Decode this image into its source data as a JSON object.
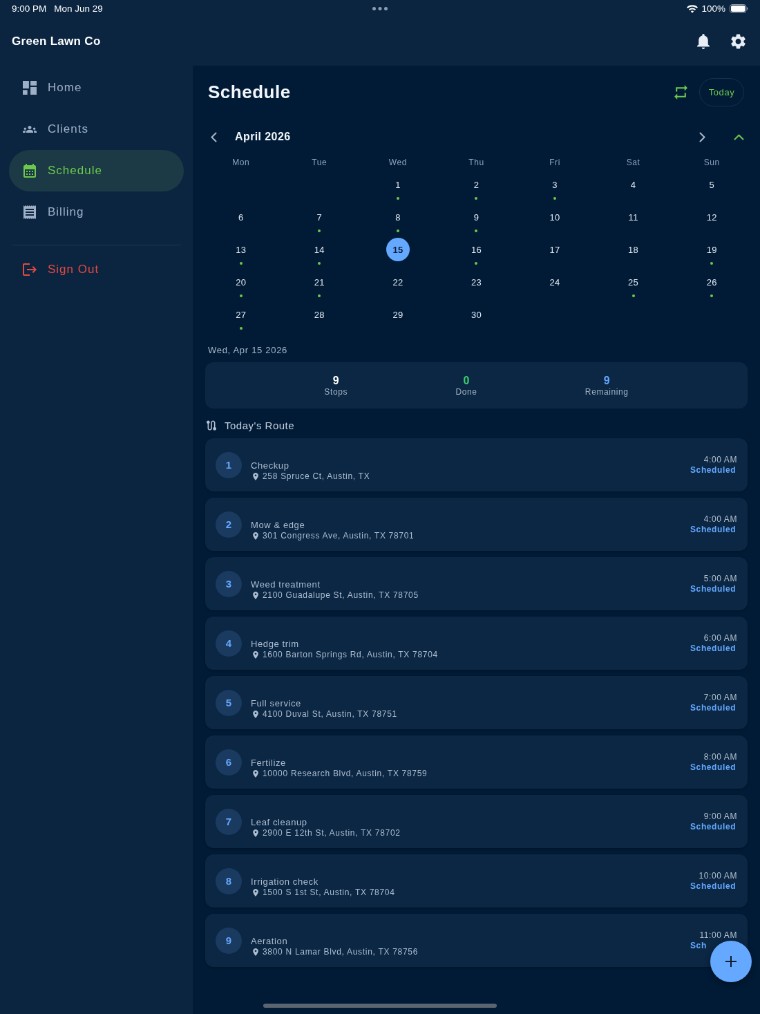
{
  "status_bar": {
    "time": "9:00 PM",
    "date": "Mon Jun 29",
    "battery": "100%"
  },
  "app_bar": {
    "title": "Green Lawn Co"
  },
  "sidebar": {
    "items": [
      {
        "label": "Home",
        "selected": false
      },
      {
        "label": "Clients",
        "selected": false
      },
      {
        "label": "Schedule",
        "selected": true
      },
      {
        "label": "Billing",
        "selected": false
      }
    ],
    "sign_out": "Sign Out"
  },
  "header": {
    "title": "Schedule",
    "today_button": "Today"
  },
  "calendar": {
    "month": "April 2026",
    "weekdays": [
      "Mon",
      "Tue",
      "Wed",
      "Thu",
      "Fri",
      "Sat",
      "Sun"
    ],
    "weeks": [
      [
        {
          "kind": "blank"
        },
        {
          "kind": "blank"
        },
        {
          "kind": "day",
          "day": "1",
          "has_jobs": true,
          "selected": false
        },
        {
          "kind": "day",
          "day": "2",
          "has_jobs": true,
          "selected": false
        },
        {
          "kind": "day",
          "day": "3",
          "has_jobs": true,
          "selected": false
        },
        {
          "kind": "day",
          "day": "4",
          "has_jobs": false,
          "selected": false
        },
        {
          "kind": "day",
          "day": "5",
          "has_jobs": false,
          "selected": false
        }
      ],
      [
        {
          "kind": "day",
          "day": "6",
          "has_jobs": false,
          "selected": false
        },
        {
          "kind": "day",
          "day": "7",
          "has_jobs": true,
          "selected": false
        },
        {
          "kind": "day",
          "day": "8",
          "has_jobs": true,
          "selected": false
        },
        {
          "kind": "day",
          "day": "9",
          "has_jobs": true,
          "selected": false
        },
        {
          "kind": "day",
          "day": "10",
          "has_jobs": false,
          "selected": false
        },
        {
          "kind": "day",
          "day": "11",
          "has_jobs": false,
          "selected": false
        },
        {
          "kind": "day",
          "day": "12",
          "has_jobs": false,
          "selected": false
        }
      ],
      [
        {
          "kind": "day",
          "day": "13",
          "has_jobs": true,
          "selected": false
        },
        {
          "kind": "day",
          "day": "14",
          "has_jobs": true,
          "selected": false
        },
        {
          "kind": "day",
          "day": "15",
          "has_jobs": false,
          "selected": true
        },
        {
          "kind": "day",
          "day": "16",
          "has_jobs": true,
          "selected": false
        },
        {
          "kind": "day",
          "day": "17",
          "has_jobs": false,
          "selected": false
        },
        {
          "kind": "day",
          "day": "18",
          "has_jobs": false,
          "selected": false
        },
        {
          "kind": "day",
          "day": "19",
          "has_jobs": true,
          "selected": false
        }
      ],
      [
        {
          "kind": "day",
          "day": "20",
          "has_jobs": true,
          "selected": false
        },
        {
          "kind": "day",
          "day": "21",
          "has_jobs": true,
          "selected": false
        },
        {
          "kind": "day",
          "day": "22",
          "has_jobs": false,
          "selected": false
        },
        {
          "kind": "day",
          "day": "23",
          "has_jobs": false,
          "selected": false
        },
        {
          "kind": "day",
          "day": "24",
          "has_jobs": false,
          "selected": false
        },
        {
          "kind": "day",
          "day": "25",
          "has_jobs": true,
          "selected": false
        },
        {
          "kind": "day",
          "day": "26",
          "has_jobs": true,
          "selected": false
        }
      ],
      [
        {
          "kind": "day",
          "day": "27",
          "has_jobs": true,
          "selected": false
        },
        {
          "kind": "day",
          "day": "28",
          "has_jobs": false,
          "selected": false
        },
        {
          "kind": "day",
          "day": "29",
          "has_jobs": false,
          "selected": false
        },
        {
          "kind": "day",
          "day": "30",
          "has_jobs": false,
          "selected": false
        }
      ]
    ]
  },
  "selected_date": "Wed, Apr 15 2026",
  "stats": [
    {
      "value": "9",
      "label": "Stops",
      "color": "#ffffff"
    },
    {
      "value": "0",
      "label": "Done",
      "color": "#3ccf6e"
    },
    {
      "value": "9",
      "label": "Remaining",
      "color": "#64a8ff"
    }
  ],
  "route": {
    "title": "Today's Route",
    "stops": [
      {
        "number": "1",
        "title": "Checkup",
        "address": "258 Spruce Ct, Austin, TX",
        "time": "4:00 AM",
        "status": "Scheduled"
      },
      {
        "number": "2",
        "title": "Mow & edge",
        "address": "301 Congress Ave, Austin, TX 78701",
        "time": "4:00 AM",
        "status": "Scheduled"
      },
      {
        "number": "3",
        "title": "Weed treatment",
        "address": "2100 Guadalupe St, Austin, TX 78705",
        "time": "5:00 AM",
        "status": "Scheduled"
      },
      {
        "number": "4",
        "title": "Hedge trim",
        "address": "1600 Barton Springs Rd, Austin, TX 78704",
        "time": "6:00 AM",
        "status": "Scheduled"
      },
      {
        "number": "5",
        "title": "Full service",
        "address": "4100 Duval St, Austin, TX 78751",
        "time": "7:00 AM",
        "status": "Scheduled"
      },
      {
        "number": "6",
        "title": "Fertilize",
        "address": "10000 Research Blvd, Austin, TX 78759",
        "time": "8:00 AM",
        "status": "Scheduled"
      },
      {
        "number": "7",
        "title": "Leaf cleanup",
        "address": "2900 E 12th St, Austin, TX 78702",
        "time": "9:00 AM",
        "status": "Scheduled"
      },
      {
        "number": "8",
        "title": "Irrigation check",
        "address": "1500 S 1st St, Austin, TX 78704",
        "time": "10:00 AM",
        "status": "Scheduled"
      },
      {
        "number": "9",
        "title": "Aeration",
        "address": "3800 N Lamar Blvd, Austin, TX 78756",
        "time": "11:00 AM",
        "status": "Sch"
      }
    ]
  }
}
